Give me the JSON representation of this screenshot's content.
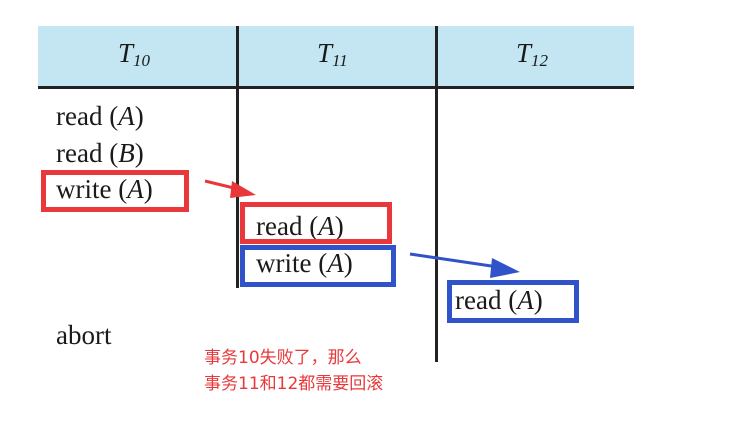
{
  "columns": [
    {
      "letter": "T",
      "sub": "10"
    },
    {
      "letter": "T",
      "sub": "11"
    },
    {
      "letter": "T",
      "sub": "12"
    }
  ],
  "t10_ops": [
    {
      "op": "read",
      "arg": "A"
    },
    {
      "op": "read",
      "arg": "B"
    },
    {
      "op": "write",
      "arg": "A"
    },
    {
      "op": "abort",
      "arg": ""
    }
  ],
  "t11_ops": [
    {
      "op": "read",
      "arg": "A"
    },
    {
      "op": "write",
      "arg": "A"
    }
  ],
  "t12_ops": [
    {
      "op": "read",
      "arg": "A"
    }
  ],
  "annotation": {
    "line1": "事务10失败了，那么",
    "line2": "事务11和12都需要回滚"
  },
  "colors": {
    "header_bg": "#c3e6f2",
    "highlight_red": "#e8383b",
    "highlight_blue": "#3153c9"
  }
}
